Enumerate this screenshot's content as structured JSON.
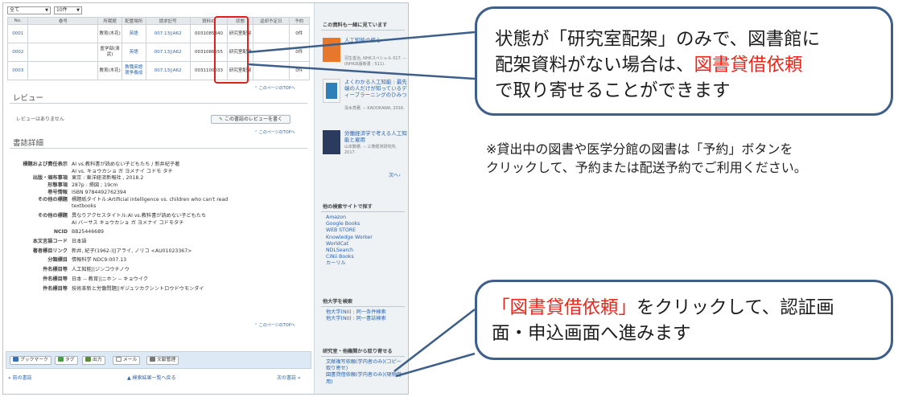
{
  "filters": {
    "sort_value": "全て",
    "count_value": "10件"
  },
  "result_table": {
    "headers": [
      "No.",
      "巻号",
      "所蔵館",
      "配置場所",
      "請求記号",
      "資料ID",
      "状態",
      "返却予定日",
      "予約"
    ],
    "rows": [
      {
        "no": "0001",
        "vol": "",
        "library": "教育(木花)",
        "location": "英語",
        "callno": "007.13||A62",
        "id": "0031085340",
        "status": "研究室配架",
        "due": "",
        "reserve": "0件"
      },
      {
        "no": "0002",
        "vol": "",
        "library": "医学部(清武)",
        "location": "英語",
        "callno": "007.13||A62",
        "id": "0031086555",
        "status": "研究室配架",
        "due": "",
        "reserve": "0件"
      },
      {
        "no": "0003",
        "vol": "",
        "library": "教育(木花)",
        "location": "教職英語競争養成",
        "callno": "007.13||A62",
        "id": "0031100033",
        "status": "研究室配架",
        "due": "",
        "reserve": "0件"
      }
    ]
  },
  "page_top": "このページのTOPへ",
  "review": {
    "heading": "レビュー",
    "empty_text": "レビューはありません",
    "write_button": "この書誌のレビューを書く"
  },
  "details": {
    "heading": "書誌詳細",
    "rows": [
      {
        "label": "標題および責任表示",
        "value": "AI vs.教科書が読めない子どもたち / 新井紀子著"
      },
      {
        "label": "",
        "value": "AI vs. キョウカショ ガ ヨメナイ コドモ タチ"
      },
      {
        "label": "出版・頒布事項",
        "value": "東京 : 東洋経済新報社 , 2018.2"
      },
      {
        "label": "形態事項",
        "value": "287p : 挿図 ; 19cm"
      },
      {
        "label": "巻号情報",
        "value": "ISBN 9784492762394"
      },
      {
        "label": "その他の標題",
        "value": "標題紙タイトル:Artificial intelligence vs. children who can't read"
      },
      {
        "label": "",
        "value": "textbooks"
      },
      {
        "label": "その他の標題",
        "value": "異なりアクセスタイトル:AI vs.教科書が読めない子どもたち"
      },
      {
        "label": "",
        "value": "AI バーサス キョウカショ ガ ヨメナイ コドモタチ"
      },
      {
        "label": "NCID",
        "value": "BB25446689"
      },
      {
        "label": "本文言語コード",
        "value": "日本語"
      },
      {
        "label": "著者標目リンク",
        "value": "新井, 紀子(1962-)||アライ, ノリコ <AU01023367>",
        "link": true
      },
      {
        "label": "分類標目",
        "value": "情報科学 NDC9:007.13",
        "link": true
      },
      {
        "label": "件名標目等",
        "value": "人工知能||ジンコウチノウ",
        "link": true
      },
      {
        "label": "件名標目等",
        "value": "日本 -- 教育||ニホン -- キョウイク",
        "link": true
      },
      {
        "label": "件名標目等",
        "value": "技術革新と労働問題||ギジュツカクシントロウドウモンダイ",
        "link": true
      }
    ]
  },
  "toolbar": {
    "bookmark": "ブックマーク",
    "tag": "タグ",
    "output": "出力",
    "mail": "メール",
    "citation": "文献管理"
  },
  "bottom_nav": {
    "prev": "前の書誌",
    "list": "検索結果一覧へ戻る",
    "next": "次の書誌"
  },
  "sidebar": {
    "also_viewed_heading": "この資料も一緒に見ています",
    "books": [
      {
        "title": "人工知能の核心",
        "meta": "羽生善治, NHKスペシャル 017. -- (NHK出版新書 ; 511)."
      },
      {
        "title": "よくわかる人工知能 : 最先端の人だけが知っているディープラーニングのひみつ",
        "meta": "清水亮著. -- KADOKAWA, 2016."
      },
      {
        "title": "労働経済学で考える人工知能と雇用",
        "meta": "山本勲著. -- 三菱経済研究所, 2017."
      }
    ],
    "next_link": "次へ",
    "other_sites_heading": "他の検索サイトで探す",
    "other_sites": [
      "Amazon",
      "Google Books",
      "WEB STORE",
      "Knowledge Worker",
      "WorldCat",
      "NDLSearch",
      "CiNii Books",
      "カーリル"
    ],
    "other_univ_heading": "他大学を検索",
    "other_univ": [
      "他大学(NII) : 同一条件検索",
      "他大学(NII) : 同一書誌検索"
    ],
    "request_heading": "研究室・他機関から取り寄せる",
    "request_links": [
      "文献複写依頼(学内者のみ)(コピー取り寄せ)",
      "図書貸借依頼(学内者のみ)(現物借用)"
    ]
  },
  "callout_top": {
    "line1": "状態が「研究室配架」のみで、図書館に",
    "line2": "配架資料がない場合は、",
    "line2_red": "図書貸借依頼",
    "line3": "で取り寄せることができます"
  },
  "note": {
    "line1": "※貸出中の図書や医学分館の図書は「予約」ボタンを",
    "line2": "クリックして、予約または配送予約でご利用ください。"
  },
  "callout_bottom": {
    "red": "「図書貸借依頼」",
    "line1_rest": "をクリックして、認証画",
    "line2": "面・申込画面へ進みます"
  },
  "colors": {
    "accent_red": "#e8261b",
    "callout_border": "#3d5f8a",
    "link_blue": "#2a64b0"
  }
}
